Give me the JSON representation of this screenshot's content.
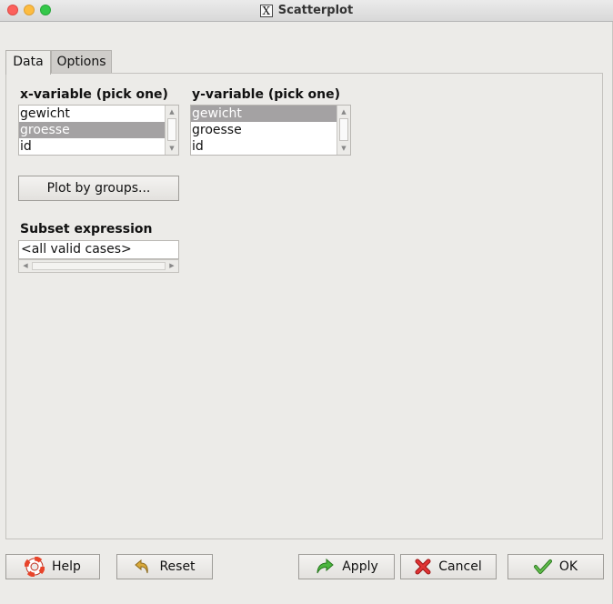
{
  "window": {
    "title": "Scatterplot"
  },
  "tabs": [
    {
      "label": "Data",
      "active": true
    },
    {
      "label": "Options",
      "active": false
    }
  ],
  "x_variable": {
    "label": "x-variable (pick one)",
    "items": [
      "gewicht",
      "groesse",
      "id"
    ],
    "selected": "groesse"
  },
  "y_variable": {
    "label": "y-variable (pick one)",
    "items": [
      "gewicht",
      "groesse",
      "id"
    ],
    "selected": "gewicht"
  },
  "plot_by_groups_label": "Plot by groups...",
  "subset": {
    "label": "Subset expression",
    "value": "<all valid cases>"
  },
  "buttons": {
    "help": "Help",
    "reset": "Reset",
    "apply": "Apply",
    "cancel": "Cancel",
    "ok": "OK"
  },
  "colors": {
    "selection": "#a4a2a3",
    "window_bg": "#ecebe8",
    "help_icon": "#e8442a",
    "reset_icon": "#c79a2a",
    "apply_icon": "#3fa535",
    "cancel_icon": "#d62a2a",
    "ok_icon": "#4aa338"
  }
}
